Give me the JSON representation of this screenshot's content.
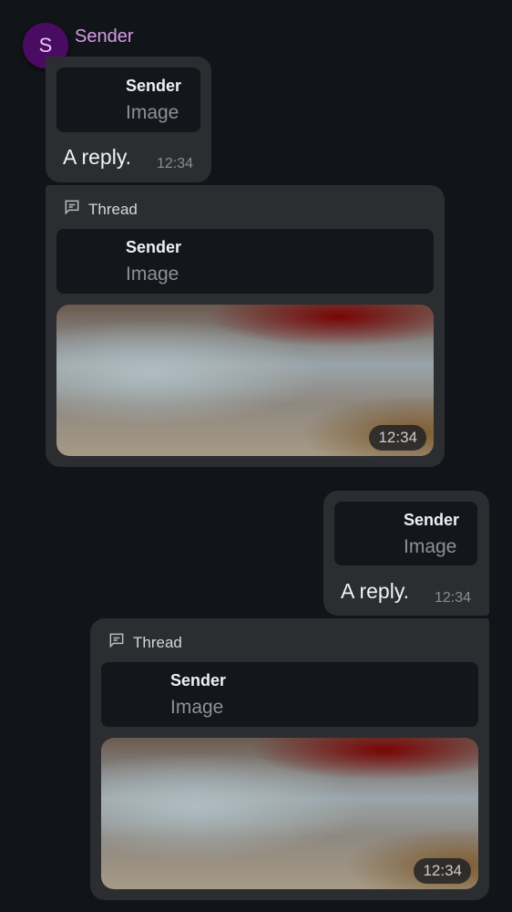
{
  "sender": {
    "initial": "S",
    "name": "Sender"
  },
  "messages": [
    {
      "reply_to": {
        "sender": "Sender",
        "body": "Image"
      },
      "text": "A reply.",
      "time": "12:34"
    },
    {
      "thread_label": "Thread",
      "reply_to": {
        "sender": "Sender",
        "body": "Image"
      },
      "media_time": "12:34"
    },
    {
      "reply_to": {
        "sender": "Sender",
        "body": "Image"
      },
      "text": "A reply.",
      "time": "12:34"
    },
    {
      "thread_label": "Thread",
      "reply_to": {
        "sender": "Sender",
        "body": "Image"
      },
      "media_time": "12:34"
    }
  ],
  "icons": {
    "thread": "thread-icon"
  },
  "colors": {
    "background": "#111418",
    "bubble": "#2b2d31",
    "reply_card": "#13161b",
    "avatar": "#4a0c62",
    "sender_name": "#d79be9"
  }
}
